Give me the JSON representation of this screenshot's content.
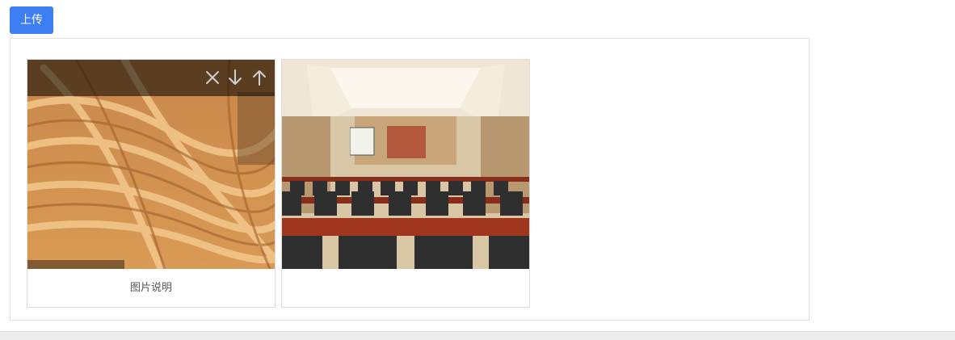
{
  "toolbar": {
    "upload_label": "上传"
  },
  "gallery": {
    "items": [
      {
        "image": "dried-bean-curd-sticks-photo",
        "caption": "图片说明",
        "actions": {
          "delete": "close-icon",
          "move_down": "arrow-down-icon",
          "move_up": "arrow-up-icon"
        }
      },
      {
        "image": "conference-hall-photo",
        "caption": ""
      }
    ]
  },
  "colors": {
    "accent": "#3e7ef4",
    "border": "#dcdcdc"
  }
}
